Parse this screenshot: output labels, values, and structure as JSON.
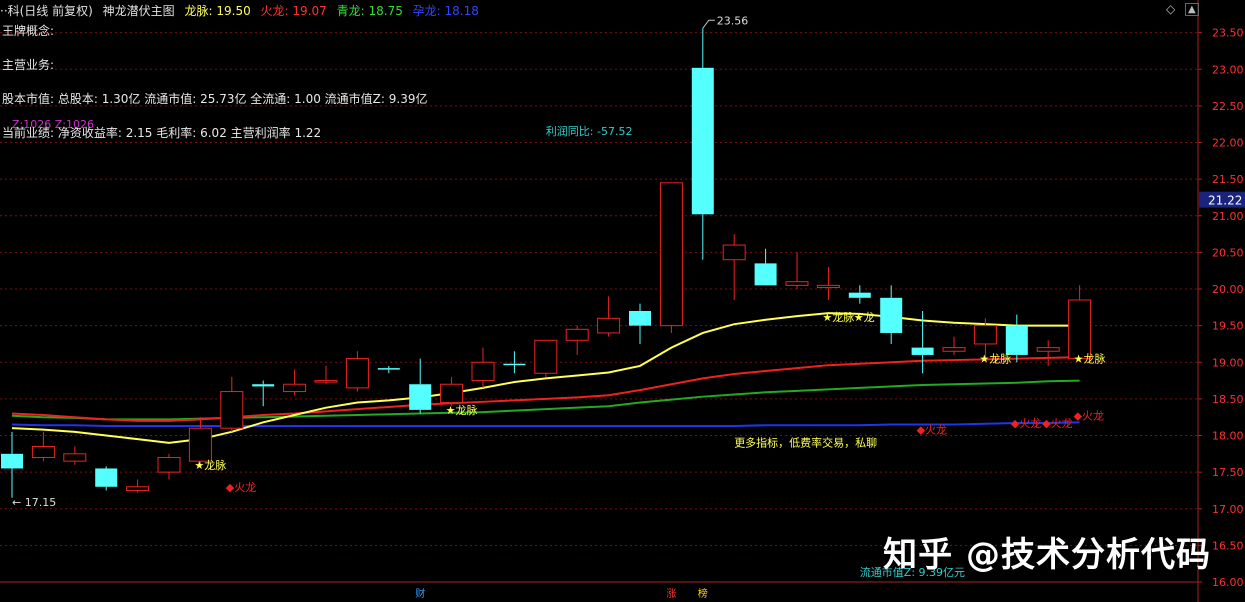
{
  "header": {
    "title": "··科(日线 前复权)",
    "indicator": "神龙潜伏主图",
    "items": [
      {
        "label": "龙脉:",
        "value": "19.50",
        "color": "#ffff55"
      },
      {
        "label": "火龙:",
        "value": "19.07",
        "color": "#ff3030"
      },
      {
        "label": "青龙:",
        "value": "18.75",
        "color": "#33dd33"
      },
      {
        "label": "孕龙:",
        "value": "18.18",
        "color": "#3344ff"
      }
    ]
  },
  "info": {
    "line1": "王牌概念:",
    "line2": "主营业务:",
    "line3": "股本市值: 总股本: 1.30亿 流通市值: 25.73亿 全流通: 1.00 流通市值Z: 9.39亿",
    "line4": "当前业绩: 净资收益率: 2.15 毛利率: 6.02 主营利润率 1.22"
  },
  "watermark": "知乎 @技术分析代码",
  "controls": {
    "diamond": "◇",
    "scroll": "▲"
  },
  "chart_data": {
    "type": "candlestick",
    "ylim": [
      16.0,
      23.7
    ],
    "y_ticks": [
      "16.00",
      "16.50",
      "17.00",
      "17.50",
      "18.00",
      "18.50",
      "19.00",
      "19.50",
      "20.00",
      "20.50",
      "21.00",
      "21.50",
      "22.00",
      "22.50",
      "23.00",
      "23.50"
    ],
    "price_label": "21.22",
    "candles": [
      {
        "o": 17.75,
        "c": 17.55,
        "h": 18.05,
        "l": 17.15
      },
      {
        "o": 17.7,
        "c": 17.85,
        "h": 18.05,
        "l": 17.65
      },
      {
        "o": 17.65,
        "c": 17.75,
        "h": 17.85,
        "l": 17.6
      },
      {
        "o": 17.55,
        "c": 17.3,
        "h": 17.58,
        "l": 17.25
      },
      {
        "o": 17.25,
        "c": 17.3,
        "h": 17.4,
        "l": 17.22
      },
      {
        "o": 17.5,
        "c": 17.7,
        "h": 17.75,
        "l": 17.4
      },
      {
        "o": 17.65,
        "c": 18.1,
        "h": 18.25,
        "l": 17.6
      },
      {
        "o": 18.1,
        "c": 18.6,
        "h": 18.8,
        "l": 18.05
      },
      {
        "o": 18.7,
        "c": 18.67,
        "h": 18.75,
        "l": 18.4
      },
      {
        "o": 18.6,
        "c": 18.7,
        "h": 18.9,
        "l": 18.55
      },
      {
        "o": 18.73,
        "c": 18.75,
        "h": 18.95,
        "l": 18.7
      },
      {
        "o": 18.65,
        "c": 19.05,
        "h": 19.15,
        "l": 18.6
      },
      {
        "o": 18.92,
        "c": 18.9,
        "h": 18.95,
        "l": 18.85
      },
      {
        "o": 18.7,
        "c": 18.35,
        "h": 19.05,
        "l": 18.3
      },
      {
        "o": 18.45,
        "c": 18.7,
        "h": 18.8,
        "l": 18.4
      },
      {
        "o": 18.75,
        "c": 19.0,
        "h": 19.2,
        "l": 18.65
      },
      {
        "o": 18.98,
        "c": 18.97,
        "h": 19.15,
        "l": 18.85
      },
      {
        "o": 18.85,
        "c": 19.3,
        "h": 19.3,
        "l": 18.8
      },
      {
        "o": 19.3,
        "c": 19.45,
        "h": 19.5,
        "l": 19.1
      },
      {
        "o": 19.4,
        "c": 19.6,
        "h": 19.9,
        "l": 19.35
      },
      {
        "o": 19.7,
        "c": 19.5,
        "h": 19.8,
        "l": 19.25
      },
      {
        "o": 19.5,
        "c": 21.45,
        "h": 21.45,
        "l": 19.4
      },
      {
        "o": 23.02,
        "c": 21.02,
        "h": 23.56,
        "l": 20.4
      },
      {
        "o": 20.4,
        "c": 20.6,
        "h": 20.75,
        "l": 19.85
      },
      {
        "o": 20.35,
        "c": 20.05,
        "h": 20.55,
        "l": 20.05
      },
      {
        "o": 20.05,
        "c": 20.1,
        "h": 20.5,
        "l": 20.0
      },
      {
        "o": 20.02,
        "c": 20.05,
        "h": 20.3,
        "l": 19.85
      },
      {
        "o": 19.95,
        "c": 19.88,
        "h": 20.05,
        "l": 19.8
      },
      {
        "o": 19.88,
        "c": 19.4,
        "h": 20.05,
        "l": 19.25
      },
      {
        "o": 19.2,
        "c": 19.1,
        "h": 19.7,
        "l": 18.85
      },
      {
        "o": 19.15,
        "c": 19.2,
        "h": 19.35,
        "l": 19.1
      },
      {
        "o": 19.25,
        "c": 19.5,
        "h": 19.6,
        "l": 19.05
      },
      {
        "o": 19.5,
        "c": 19.1,
        "h": 19.65,
        "l": 19.0
      },
      {
        "o": 19.15,
        "c": 19.2,
        "h": 19.3,
        "l": 18.95
      },
      {
        "o": 19.05,
        "c": 19.85,
        "h": 20.05,
        "l": 19.0
      }
    ],
    "series": [
      {
        "name": "龙脉",
        "color": "#ffff55",
        "values": [
          18.1,
          18.08,
          18.05,
          18.0,
          17.95,
          17.9,
          17.95,
          18.05,
          18.18,
          18.28,
          18.38,
          18.45,
          18.48,
          18.52,
          18.58,
          18.65,
          18.73,
          18.78,
          18.82,
          18.86,
          18.95,
          19.2,
          19.4,
          19.52,
          19.58,
          19.63,
          19.67,
          19.66,
          19.62,
          19.57,
          19.54,
          19.52,
          19.5,
          19.5,
          19.5
        ]
      },
      {
        "name": "火龙",
        "color": "#ee2222",
        "values": [
          18.3,
          18.28,
          18.25,
          18.22,
          18.2,
          18.2,
          18.22,
          18.25,
          18.28,
          18.3,
          18.33,
          18.36,
          18.39,
          18.42,
          18.44,
          18.46,
          18.48,
          18.5,
          18.52,
          18.55,
          18.62,
          18.7,
          18.78,
          18.84,
          18.88,
          18.92,
          18.96,
          18.98,
          19.0,
          19.02,
          19.03,
          19.04,
          19.05,
          19.06,
          19.07
        ]
      },
      {
        "name": "青龙",
        "color": "#22aa22",
        "values": [
          18.27,
          18.25,
          18.24,
          18.22,
          18.22,
          18.22,
          18.23,
          18.24,
          18.25,
          18.26,
          18.27,
          18.28,
          18.29,
          18.3,
          18.31,
          18.32,
          18.34,
          18.36,
          18.38,
          18.4,
          18.45,
          18.49,
          18.53,
          18.56,
          18.59,
          18.61,
          18.63,
          18.65,
          18.67,
          18.69,
          18.7,
          18.71,
          18.72,
          18.74,
          18.75
        ]
      },
      {
        "name": "孕龙",
        "color": "#2233ee",
        "values": [
          18.15,
          18.14,
          18.14,
          18.13,
          18.13,
          18.13,
          18.13,
          18.13,
          18.13,
          18.13,
          18.13,
          18.13,
          18.13,
          18.13,
          18.13,
          18.13,
          18.13,
          18.13,
          18.13,
          18.13,
          18.13,
          18.13,
          18.13,
          18.13,
          18.14,
          18.14,
          18.14,
          18.14,
          18.15,
          18.15,
          18.15,
          18.16,
          18.17,
          18.17,
          18.18
        ]
      }
    ],
    "annotations": [
      {
        "text": "← 17.15",
        "i": 0,
        "y": 17.15,
        "color": "#dddddd"
      },
      {
        "text": "23.56",
        "i": 22,
        "y": 23.56,
        "color": "#dddddd"
      },
      {
        "text": "利润同比: -57.52",
        "i": 17,
        "y": 22.1,
        "color": "#33cccc"
      },
      {
        "text": "更多指标，低费率交易，私聊",
        "i": 23,
        "y": 17.85,
        "color": "#ffff55"
      },
      {
        "text": "流通市值Z: 9.39亿元",
        "i": 27,
        "y": 16.08,
        "color": "#33cccc"
      },
      {
        "text": "Z:1026  Z:1026",
        "i": 0,
        "y": 22.2,
        "color": "#cc33cc"
      }
    ],
    "markers": [
      {
        "text": "★龙脉",
        "i": 6,
        "y": 17.6,
        "color": "#ffff55"
      },
      {
        "text": "◆火龙",
        "i": 7,
        "y": 17.3,
        "color": "#ee2222"
      },
      {
        "text": "★龙脉",
        "i": 14,
        "y": 18.35,
        "color": "#ffff55"
      },
      {
        "text": "★龙脉",
        "i": 26,
        "y": 19.62,
        "color": "#ffff55"
      },
      {
        "text": "★龙",
        "i": 27,
        "y": 19.62,
        "color": "#ffff55"
      },
      {
        "text": "◆火龙",
        "i": 29,
        "y": 18.08,
        "color": "#ee2222"
      },
      {
        "text": "★龙脉",
        "i": 31,
        "y": 19.05,
        "color": "#ffff55"
      },
      {
        "text": "◆火龙",
        "i": 32,
        "y": 18.17,
        "color": "#ee2222"
      },
      {
        "text": "◆火龙",
        "i": 33,
        "y": 18.17,
        "color": "#ee2222"
      },
      {
        "text": "★龙脉",
        "i": 34,
        "y": 19.05,
        "color": "#ffff55"
      },
      {
        "text": "◆火龙",
        "i": 34,
        "y": 18.27,
        "color": "#ee2222"
      }
    ],
    "bottom_labels": [
      {
        "text": "财",
        "i": 13,
        "color": "#3399ff"
      },
      {
        "text": "涨",
        "i": 21,
        "color": "#ff3333"
      },
      {
        "text": "榜",
        "i": 22,
        "color": "#ffcc00"
      }
    ],
    "colors": {
      "up": "#ee2222",
      "down": "#55ffff",
      "grid": "#7a1010",
      "axis": "#aa2222"
    }
  }
}
